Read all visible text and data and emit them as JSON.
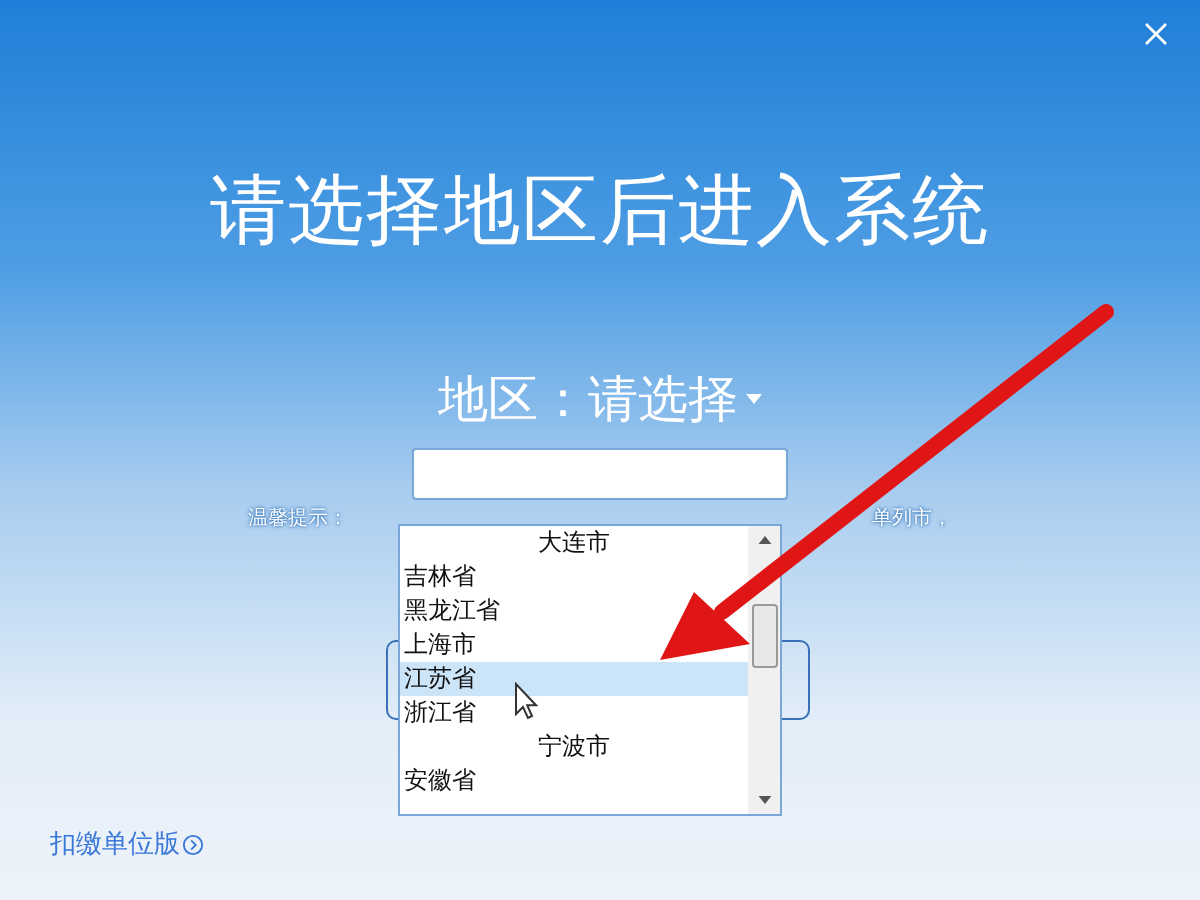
{
  "title": "请选择地区后进入系统",
  "region": {
    "label": "地区：",
    "value": "请选择"
  },
  "hint": {
    "start": "温馨提示：",
    "end": "单列市，"
  },
  "dropdown": {
    "items": [
      {
        "label": "大连市",
        "kind": "city",
        "selected": false
      },
      {
        "label": "吉林省",
        "kind": "province",
        "selected": false
      },
      {
        "label": "黑龙江省",
        "kind": "province",
        "selected": false
      },
      {
        "label": "上海市",
        "kind": "province",
        "selected": false
      },
      {
        "label": "江苏省",
        "kind": "province",
        "selected": true
      },
      {
        "label": "浙江省",
        "kind": "province",
        "selected": false
      },
      {
        "label": "宁波市",
        "kind": "city",
        "selected": false
      },
      {
        "label": "安徽省",
        "kind": "province",
        "selected": false
      }
    ]
  },
  "footer_link": "扣缴单位版"
}
